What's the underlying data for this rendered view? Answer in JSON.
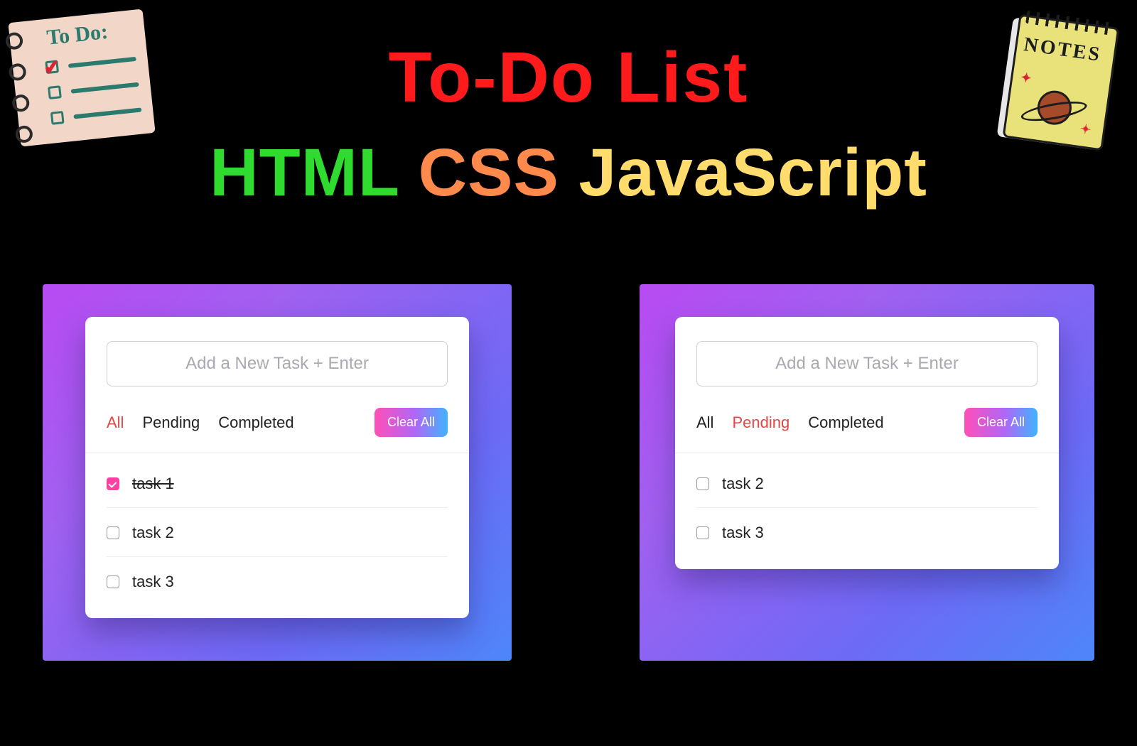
{
  "hero": {
    "title": "To-Do List",
    "tech_html": "HTML",
    "tech_css": "CSS",
    "tech_js": "JavaScript"
  },
  "doodle_todo_label": "To Do:",
  "doodle_notes_label": "NOTES",
  "apps": {
    "left": {
      "input_placeholder": "Add a New Task + Enter",
      "tabs": {
        "all": "All",
        "pending": "Pending",
        "completed": "Completed",
        "active": "all"
      },
      "clear_label": "Clear All",
      "tasks": [
        {
          "label": "task 1",
          "done": true
        },
        {
          "label": "task 2",
          "done": false
        },
        {
          "label": "task 3",
          "done": false
        }
      ]
    },
    "right": {
      "input_placeholder": "Add a New Task + Enter",
      "tabs": {
        "all": "All",
        "pending": "Pending",
        "completed": "Completed",
        "active": "pending"
      },
      "clear_label": "Clear All",
      "tasks": [
        {
          "label": "task 2",
          "done": false
        },
        {
          "label": "task 3",
          "done": false
        }
      ]
    }
  }
}
